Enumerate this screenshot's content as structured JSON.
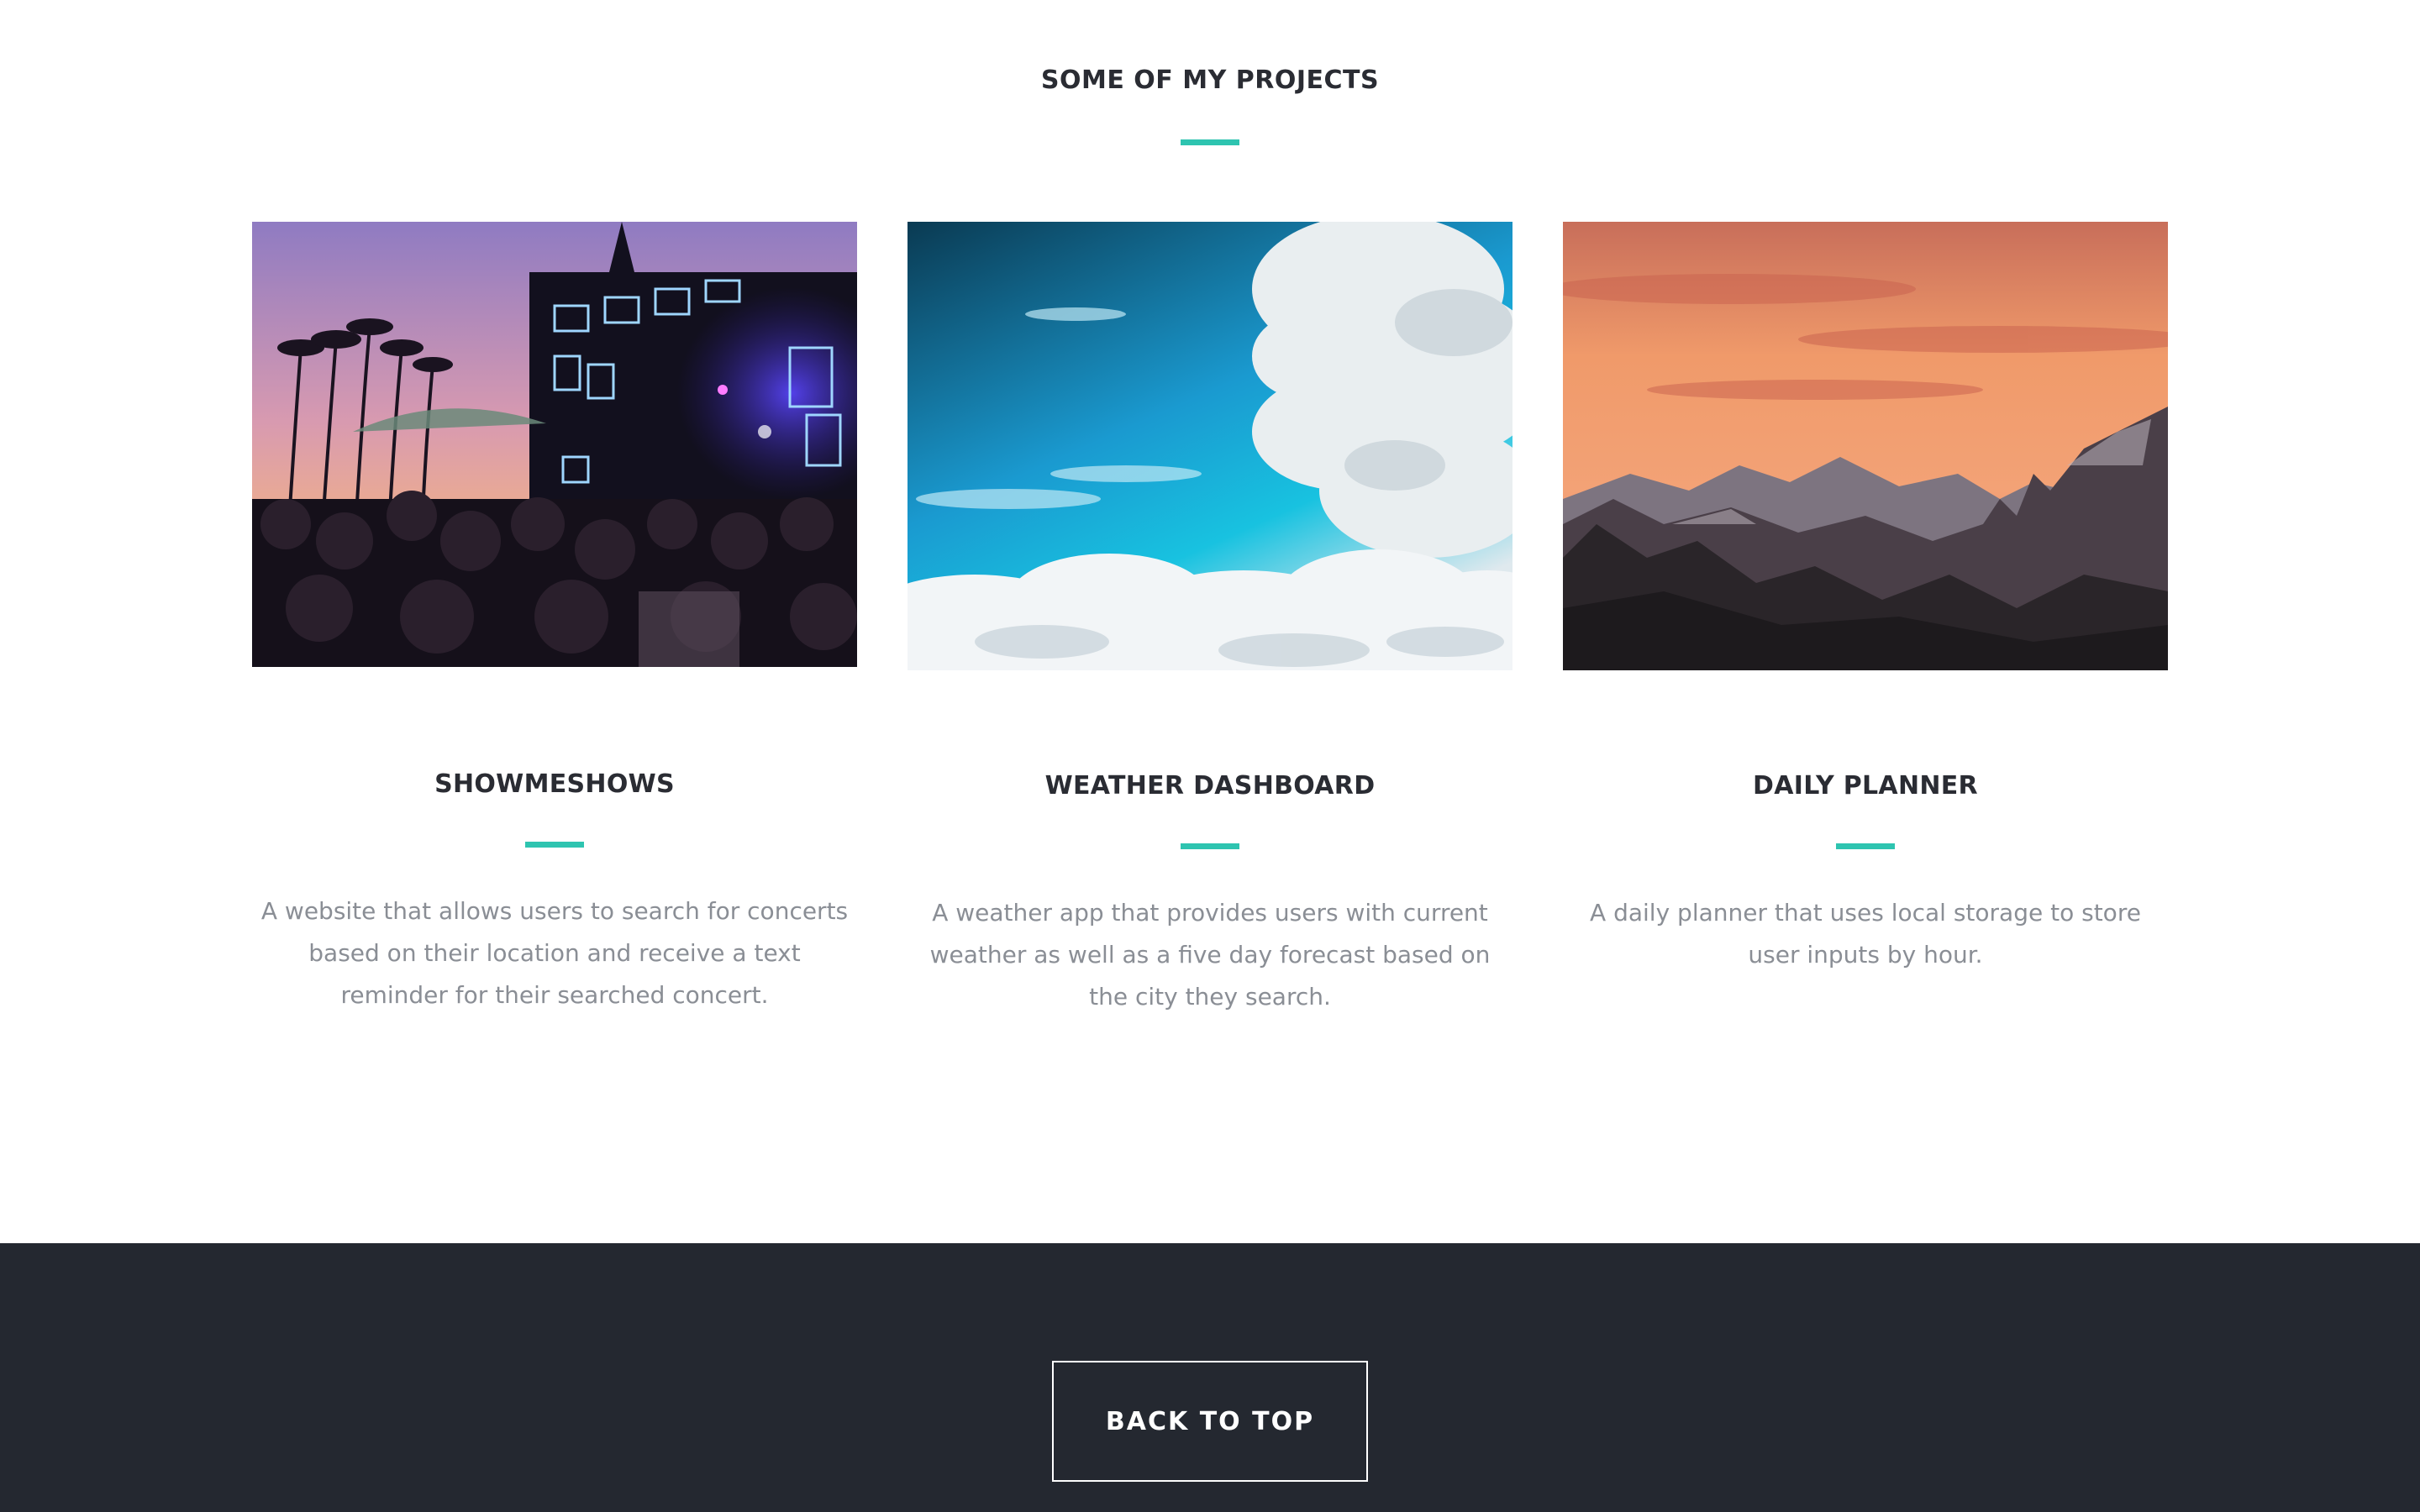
{
  "section": {
    "title": "SOME OF MY PROJECTS",
    "accent_color": "#2ec4b0"
  },
  "projects": [
    {
      "title": "SHOWMESHOWS",
      "description": "A website that allows users to search for concerts based on their location and receive a text reminder for their searched concert.",
      "image": "concert-crowd-image"
    },
    {
      "title": "WEATHER DASHBOARD",
      "description": "A weather app that provides users with current weather as well as a five day forecast based on the city they search.",
      "image": "sky-clouds-image"
    },
    {
      "title": "DAILY PLANNER",
      "description": "A daily planner that uses local storage to store user inputs by hour.",
      "image": "mountain-sunset-image"
    }
  ],
  "footer": {
    "back_to_top_label": "BACK TO TOP",
    "background": "#242830"
  }
}
